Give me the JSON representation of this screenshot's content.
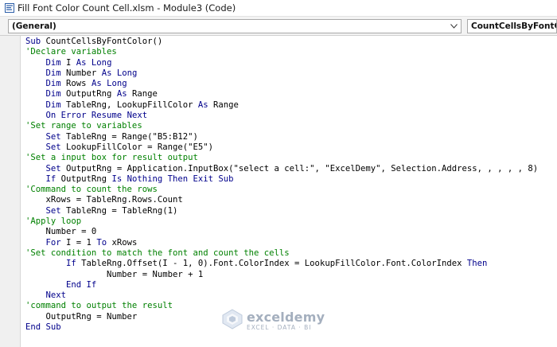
{
  "window": {
    "title": "Fill Font Color Count Cell.xlsm - Module3 (Code)",
    "icon": "vba-module-icon"
  },
  "toolbar": {
    "object_combo": "(General)",
    "procedure_combo": "CountCellsByFontColor",
    "arrow_icon": "chevron-down-icon"
  },
  "code": {
    "lines": [
      [
        {
          "t": "Sub CountCellsByFontColor()",
          "c": "kwsub"
        }
      ],
      [
        {
          "t": "'Declare variables",
          "c": "cm"
        }
      ],
      [
        {
          "t": "    "
        },
        {
          "t": "Dim",
          "c": "kw"
        },
        {
          "t": " I "
        },
        {
          "t": "As Long",
          "c": "kw"
        }
      ],
      [
        {
          "t": "    "
        },
        {
          "t": "Dim",
          "c": "kw"
        },
        {
          "t": " Number "
        },
        {
          "t": "As Long",
          "c": "kw"
        }
      ],
      [
        {
          "t": "    "
        },
        {
          "t": "Dim",
          "c": "kw"
        },
        {
          "t": " Rows "
        },
        {
          "t": "As Long",
          "c": "kw"
        }
      ],
      [
        {
          "t": "    "
        },
        {
          "t": "Dim",
          "c": "kw"
        },
        {
          "t": " OutputRng "
        },
        {
          "t": "As",
          "c": "kw"
        },
        {
          "t": " Range"
        }
      ],
      [
        {
          "t": "    "
        },
        {
          "t": "Dim",
          "c": "kw"
        },
        {
          "t": " TableRng, LookupFillColor "
        },
        {
          "t": "As",
          "c": "kw"
        },
        {
          "t": " Range"
        }
      ],
      [
        {
          "t": "    "
        },
        {
          "t": "On Error Resume Next",
          "c": "kw"
        }
      ],
      [
        {
          "t": "'Set range to variables",
          "c": "cm"
        }
      ],
      [
        {
          "t": "    "
        },
        {
          "t": "Set",
          "c": "kw"
        },
        {
          "t": " TableRng = Range(\"B5:B12\")"
        }
      ],
      [
        {
          "t": "    "
        },
        {
          "t": "Set",
          "c": "kw"
        },
        {
          "t": " LookupFillColor = Range(\"E5\")"
        }
      ],
      [
        {
          "t": "'Set a input box for result output",
          "c": "cm"
        }
      ],
      [
        {
          "t": "    "
        },
        {
          "t": "Set",
          "c": "kw"
        },
        {
          "t": " OutputRng = Application.InputBox(\"select a cell:\", \"ExcelDemy\", Selection.Address, , , , , 8)"
        }
      ],
      [
        {
          "t": "    "
        },
        {
          "t": "If",
          "c": "kw"
        },
        {
          "t": " OutputRng "
        },
        {
          "t": "Is Nothing Then Exit Sub",
          "c": "kw"
        }
      ],
      [
        {
          "t": "'Command to count the rows",
          "c": "cm"
        }
      ],
      [
        {
          "t": "    xRows = TableRng.Rows.Count"
        }
      ],
      [
        {
          "t": "    "
        },
        {
          "t": "Set",
          "c": "kw"
        },
        {
          "t": " TableRng = TableRng(1)"
        }
      ],
      [
        {
          "t": "'Apply loop",
          "c": "cm"
        }
      ],
      [
        {
          "t": "    Number = 0"
        }
      ],
      [
        {
          "t": "    "
        },
        {
          "t": "For",
          "c": "kw"
        },
        {
          "t": " I = 1 "
        },
        {
          "t": "To",
          "c": "kw"
        },
        {
          "t": " xRows"
        }
      ],
      [
        {
          "t": "'Set condition to match the font and count the cells",
          "c": "cm"
        }
      ],
      [
        {
          "t": "        "
        },
        {
          "t": "If",
          "c": "kw"
        },
        {
          "t": " TableRng.Offset(I - 1, 0).Font.ColorIndex = LookupFillColor.Font.ColorIndex "
        },
        {
          "t": "Then",
          "c": "kw"
        }
      ],
      [
        {
          "t": "                Number = Number + 1"
        }
      ],
      [
        {
          "t": "        "
        },
        {
          "t": "End If",
          "c": "kw"
        }
      ],
      [
        {
          "t": "    "
        },
        {
          "t": "Next",
          "c": "kw"
        }
      ],
      [
        {
          "t": "'command to output the result",
          "c": "cm"
        }
      ],
      [
        {
          "t": "    OutputRng = Number"
        }
      ],
      [
        {
          "t": "End Sub",
          "c": "kw"
        }
      ]
    ]
  },
  "watermark": {
    "name": "exceldemy",
    "tagline": "EXCEL · DATA · BI",
    "icon": "exceldemy-logo-icon"
  },
  "colors": {
    "keyword": "#00008b",
    "comment": "#008000",
    "text": "#000000"
  }
}
